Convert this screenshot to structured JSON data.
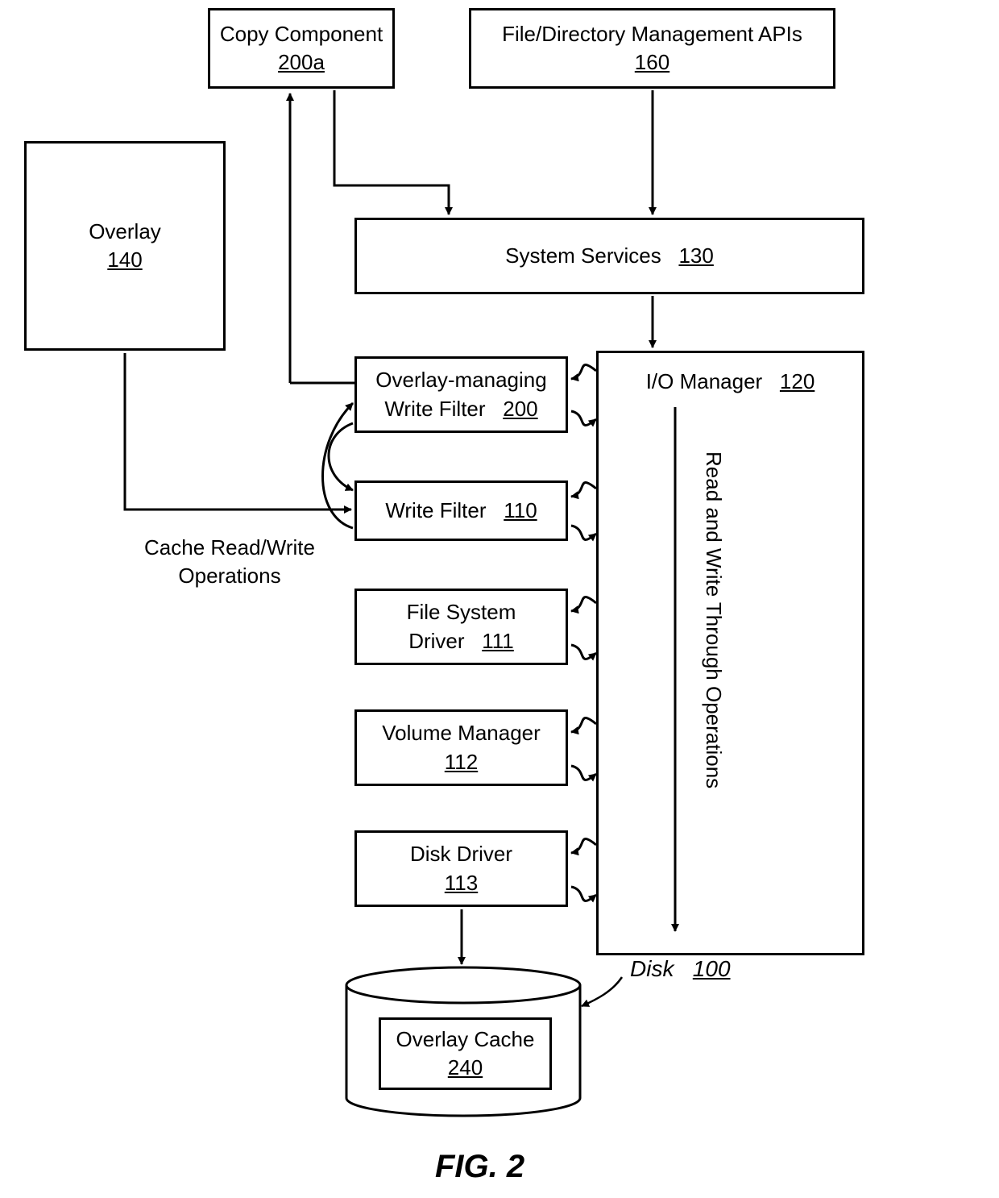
{
  "copyComponent": {
    "label": "Copy Component",
    "ref": "200a"
  },
  "apis": {
    "label": "File/Directory Management APIs",
    "ref": "160"
  },
  "overlay": {
    "label": "Overlay",
    "ref": "140"
  },
  "systemServices": {
    "label": "System Services",
    "ref": "130"
  },
  "ioManager": {
    "label": "I/O Manager",
    "ref": "120"
  },
  "overlayManagingWF": {
    "line1": "Overlay-managing",
    "line2": "Write Filter",
    "ref": "200"
  },
  "writeFilter": {
    "label": "Write Filter",
    "ref": "110"
  },
  "fsDriver": {
    "line1": "File System",
    "line2": "Driver",
    "ref": "111"
  },
  "volumeManager": {
    "label": "Volume Manager",
    "ref": "112"
  },
  "diskDriver": {
    "label": "Disk Driver",
    "ref": "113"
  },
  "overlayCache": {
    "label": "Overlay Cache",
    "ref": "240"
  },
  "disk": {
    "label": "Disk",
    "ref": "100"
  },
  "cacheOps": {
    "line1": "Cache Read/Write",
    "line2": "Operations"
  },
  "rwThrough": {
    "label": "Read and Write Through Operations"
  },
  "figure": {
    "label": "FIG. 2"
  }
}
